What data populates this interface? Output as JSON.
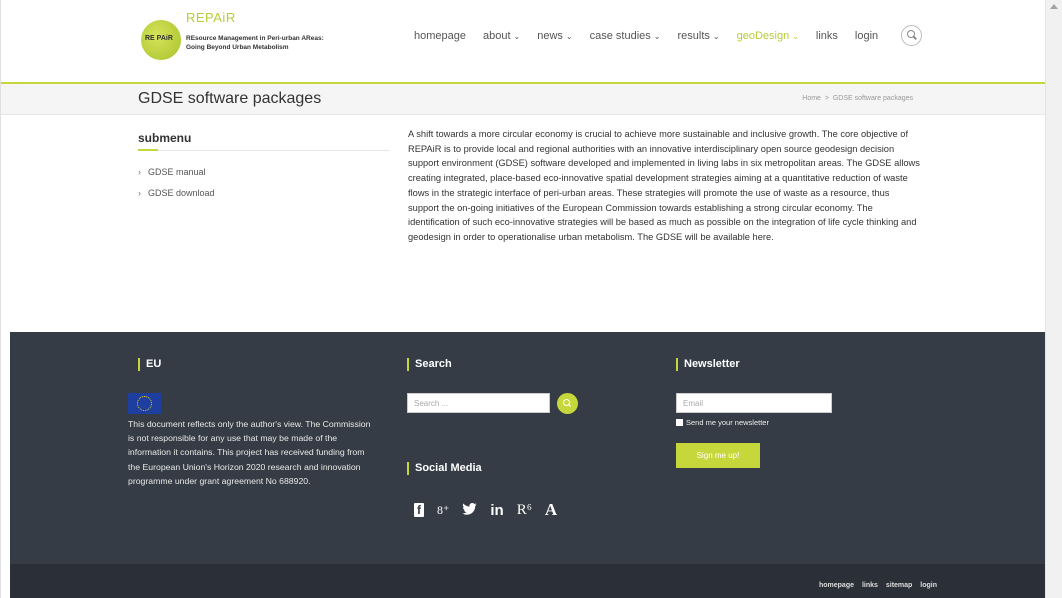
{
  "logo": {
    "title": "REPAiR",
    "mark": "RE PAiR",
    "subtitle_line1": "REsource Management in Peri-urban AReas:",
    "subtitle_line2": "Going Beyond Urban Metabolism"
  },
  "nav": {
    "items": [
      {
        "label": "homepage",
        "dropdown": false
      },
      {
        "label": "about",
        "dropdown": true
      },
      {
        "label": "news",
        "dropdown": true
      },
      {
        "label": "case studies",
        "dropdown": true
      },
      {
        "label": "results",
        "dropdown": true
      },
      {
        "label": "geoDesign",
        "dropdown": true,
        "active": true
      },
      {
        "label": "links",
        "dropdown": false
      },
      {
        "label": "login",
        "dropdown": false
      }
    ],
    "search_icon": "search-icon"
  },
  "page": {
    "title": "GDSE software packages",
    "breadcrumb_home": "Home",
    "breadcrumb_sep": ">",
    "breadcrumb_current": "GDSE software packages"
  },
  "submenu": {
    "title": "submenu",
    "items": [
      "GDSE manual",
      "GDSE download"
    ]
  },
  "content": {
    "text": "A shift towards a more circular economy is crucial to achieve more sustainable and inclusive growth. The core objective of REPAiR is to provide local and regional authorities with an innovative interdisciplinary open source geodesign decision support environment (GDSE) software developed and implemented in living labs in six metropolitan areas. The GDSE allows creating integrated, place-based eco-innovative spatial development strategies aiming at a quantitative reduction of waste flows in the strategic interface of peri-urban areas. These strategies will promote the use of waste as a resource, thus support the on-going initiatives of the European Commission towards establishing a strong circular economy. The identification of such eco-innovative strategies will be based as much as possible on the integration of life cycle thinking and geodesign in order to operationalise urban metabolism. The GDSE will be available here."
  },
  "footer": {
    "eu_heading": "EU",
    "eu_text": "This document reflects only the author's view. The Commission is not responsible for any use that may be made of the information it contains. This project has received funding from the European Union's Horizon 2020 research and innovation programme under grant agreement No 688920.",
    "search_heading": "Search",
    "search_placeholder": "Search ...",
    "social_heading": "Social Media",
    "social_icons": [
      {
        "icon": "facebook-icon",
        "glyph": "f"
      },
      {
        "icon": "google-plus-icon",
        "glyph": "8⁺"
      },
      {
        "icon": "twitter-icon",
        "glyph": "🐦"
      },
      {
        "icon": "linkedin-icon",
        "glyph": "in"
      },
      {
        "icon": "researchgate-icon",
        "glyph": "R⁶"
      },
      {
        "icon": "academia-icon",
        "glyph": "A"
      }
    ],
    "newsletter_heading": "Newsletter",
    "email_placeholder": "Email",
    "newsletter_checkbox": "Send me your newsletter",
    "signup_label": "Sign me up!",
    "bottom_links": [
      "homepage",
      "links",
      "sitemap",
      "login"
    ]
  },
  "colors": {
    "accent": "#c6d73b",
    "footer_bg": "#353c45"
  }
}
